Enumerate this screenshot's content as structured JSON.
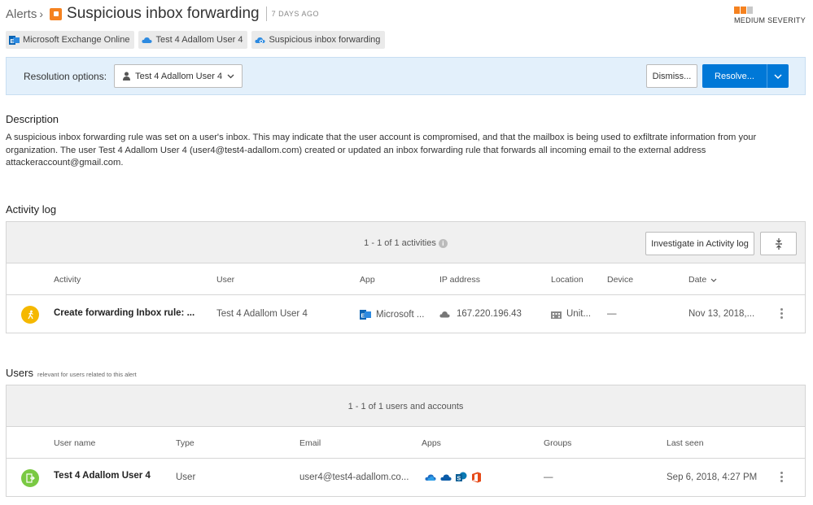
{
  "header": {
    "breadcrumb": "Alerts",
    "breadcrumb_sep": "›",
    "title": "Suspicious inbox forwarding",
    "age": "7 DAYS AGO",
    "severity_label": "MEDIUM SEVERITY",
    "severity_colors": [
      "#f58220",
      "#f58220",
      "#c8c8c8"
    ]
  },
  "tags": [
    {
      "icon": "exchange-icon",
      "label": "Microsoft Exchange Online"
    },
    {
      "icon": "cloud-user-icon",
      "label": "Test 4 Adallom User 4"
    },
    {
      "icon": "cloud-policy-icon",
      "label": "Suspicious inbox forwarding"
    }
  ],
  "resolution": {
    "label": "Resolution options:",
    "selected_user": "Test 4 Adallom User 4",
    "dismiss_label": "Dismiss...",
    "resolve_label": "Resolve...",
    "accent_color": "#0078d7"
  },
  "description": {
    "title": "Description",
    "text": "A suspicious inbox forwarding rule was set on a user's inbox. This may indicate that the user account is compromised, and that the mailbox is being used to exfiltrate information from your organization. The user Test 4 Adallom User 4 (user4@test4-adallom.com) created or updated an inbox forwarding rule that forwards all incoming email to the external address attackeraccount@gmail.com."
  },
  "activity_log": {
    "title": "Activity log",
    "count_text": "1 - 1 of 1 activities",
    "investigate_label": "Investigate in Activity log",
    "columns": {
      "activity": "Activity",
      "user": "User",
      "app": "App",
      "ip": "IP address",
      "location": "Location",
      "device": "Device",
      "date": "Date"
    },
    "rows": [
      {
        "activity": "Create forwarding Inbox rule: ...",
        "user": "Test 4 Adallom User 4",
        "app": "Microsoft ...",
        "ip": "167.220.196.43",
        "location": "Unit...",
        "device": "—",
        "date": "Nov 13, 2018,..."
      }
    ]
  },
  "users": {
    "title": "Users",
    "subtitle": "relevant for users related to this alert",
    "count_text": "1 - 1 of 1 users and accounts",
    "columns": {
      "name": "User name",
      "type": "Type",
      "email": "Email",
      "apps": "Apps",
      "groups": "Groups",
      "last_seen": "Last seen"
    },
    "rows": [
      {
        "name": "Test 4 Adallom User 4",
        "type": "User",
        "email": "user4@test4-adallom.co...",
        "apps": [
          "onedrive-icon",
          "cloud-icon",
          "sharepoint-icon",
          "office-icon"
        ],
        "groups": "—",
        "last_seen": "Sep 6, 2018, 4:27 PM"
      }
    ]
  }
}
